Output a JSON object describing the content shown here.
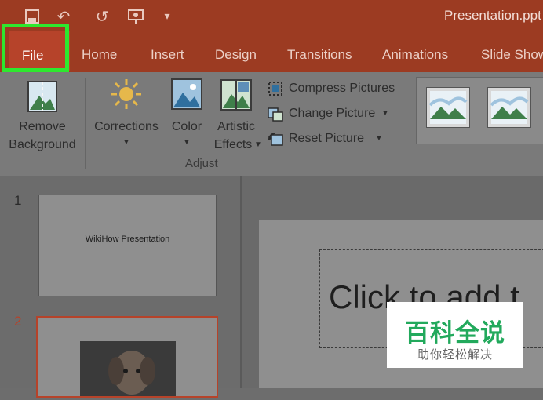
{
  "window": {
    "title": "Presentation.ppt"
  },
  "quick_access": {
    "icons": [
      "save-icon",
      "undo-icon",
      "redo-icon",
      "present-icon",
      "customize-icon"
    ]
  },
  "tabs": [
    "File",
    "Home",
    "Insert",
    "Design",
    "Transitions",
    "Animations",
    "Slide Show"
  ],
  "ribbon": {
    "remove_background": [
      "Remove",
      "Background"
    ],
    "corrections": "Corrections",
    "color": "Color",
    "artistic": [
      "Artistic",
      "Effects"
    ],
    "compress": "Compress Pictures",
    "change": "Change Picture",
    "reset": "Reset Picture",
    "group_label": "Adjust"
  },
  "slides": [
    {
      "number": "1",
      "title": "WikiHow Presentation"
    },
    {
      "number": "2"
    }
  ],
  "editor": {
    "placeholder": "Click to add t"
  },
  "watermark": {
    "title": "百科全说",
    "subtitle": "助你轻松解决"
  },
  "colors": {
    "titlebar": "#9c3b22",
    "file_tab": "#b6432a",
    "highlight": "#2ee82e",
    "watermark_green": "#22a95c"
  }
}
